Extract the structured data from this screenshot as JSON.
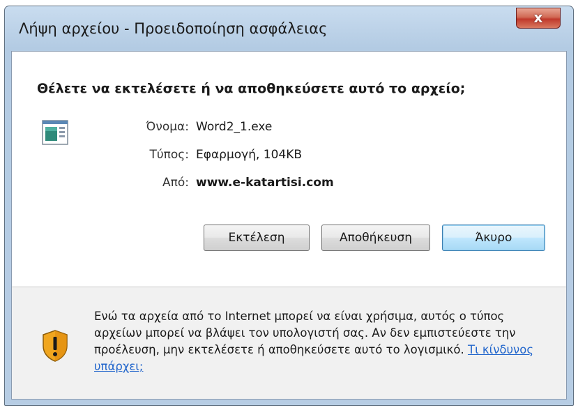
{
  "window": {
    "title": "Λήψη αρχείου - Προειδοποίηση ασφάλειας",
    "close_label": "x"
  },
  "dialog": {
    "question": "Θέλετε να εκτελέσετε ή να αποθηκεύσετε αυτό το αρχείο;",
    "icon": "application-file-icon",
    "properties": [
      {
        "label": "Όνομα:",
        "value": "Word2_1.exe",
        "bold": false
      },
      {
        "label": "Τύπος:",
        "value": "Εφαρμογή, 104KB",
        "bold": false
      },
      {
        "label": "Από:",
        "value": "www.e-katartisi.com",
        "bold": true
      }
    ],
    "buttons": {
      "run": "Εκτέλεση",
      "save": "Αποθήκευση",
      "cancel": "Άκυρο"
    }
  },
  "warning": {
    "icon": "security-shield-icon",
    "text": "Ενώ τα αρχεία από το Internet μπορεί να είναι χρήσιμα, αυτός ο τύπος αρχείων μπορεί να βλάψει τον υπολογιστή σας. Αν δεν εμπιστεύεστε την προέλευση, μην εκτελέσετε ή αποθηκεύσετε αυτό το λογισμικό.",
    "link": "Τι κίνδυνος υπάρχει;"
  },
  "colors": {
    "frame": "#b7cde4",
    "close_button": "#c0392b",
    "link": "#2266cc",
    "warning_background": "#f1f1f1"
  }
}
